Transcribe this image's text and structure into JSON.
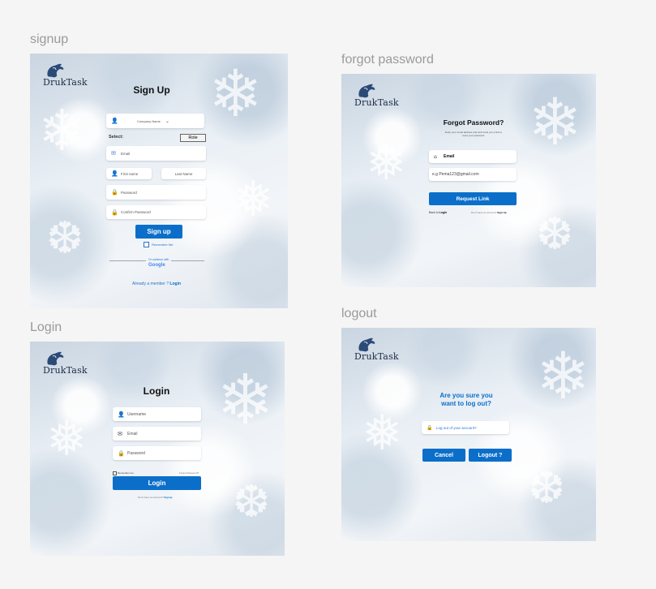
{
  "frames": {
    "signup": {
      "label": "signup",
      "logo_text": "DrukTask",
      "title": "Sign Up",
      "company_select": "Company Name",
      "select_label": "Select:",
      "role_button": "Role",
      "email_placeholder": "Email",
      "first_name_placeholder": "First name",
      "last_name_placeholder": "Last Name",
      "password_placeholder": "Password",
      "confirm_password_placeholder": "Confirm Password",
      "signup_button": "Sign up",
      "remember_me": "Remember Me",
      "divider_text": "Or continue with",
      "google_text": "Google",
      "already_member": "Already a member ?",
      "login_link": "Login"
    },
    "forgot_password": {
      "label": "forgot password",
      "logo_text": "DrukTask",
      "title": "Forgot Password?",
      "subtitle": "Enter your email address and we'll send you a link to reset your password.",
      "email_label": "Email",
      "email_value": "e.g Pema123@gmail.com",
      "request_button": "Request Link",
      "back_to": "Back to",
      "back_login": "Login",
      "no_account": "Don't have an account?",
      "signup_link": "Sign Up"
    },
    "login": {
      "label": "Login",
      "logo_text": "DrukTask",
      "title": "Login",
      "username_placeholder": "Username",
      "email_placeholder": "Email",
      "password_placeholder": "Password",
      "remember_me": "Remember me",
      "forgot_password": "Forgot Password?",
      "login_button": "Login",
      "no_account": "Don't have an account?",
      "signup_link": "Signup"
    },
    "logout": {
      "label": "logout",
      "logo_text": "DrukTask",
      "question_line1": "Are you sure you",
      "question_line2": "want to log out?",
      "logout_field": "Log out of your account?",
      "cancel_button": "Cancel",
      "logout_button": "Logout ?"
    }
  },
  "colors": {
    "primary": "#0b6fca",
    "logo": "#1d2b44",
    "label": "#9a9a9a"
  },
  "icons": [
    "dragon-logo-icon",
    "user-icon",
    "mail-icon",
    "lock-icon",
    "home-icon",
    "chevron-down-icon",
    "checkbox-icon"
  ]
}
